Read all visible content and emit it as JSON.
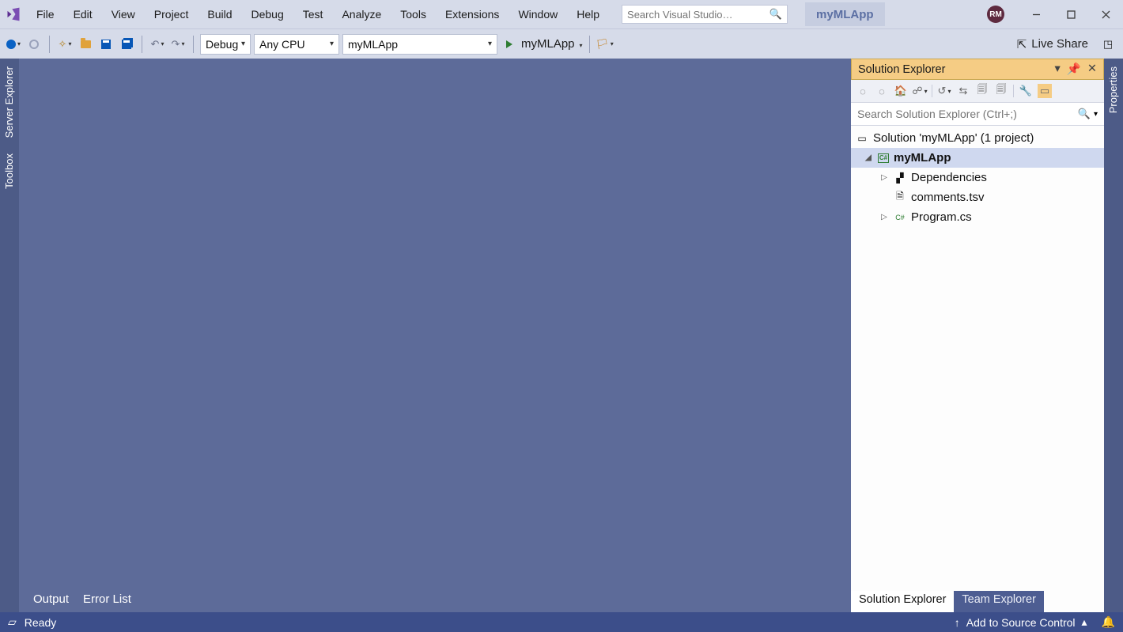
{
  "menu": [
    "File",
    "Edit",
    "View",
    "Project",
    "Build",
    "Debug",
    "Test",
    "Analyze",
    "Tools",
    "Extensions",
    "Window",
    "Help"
  ],
  "search_placeholder": "Search Visual Studio…",
  "app_name": "myMLApp",
  "avatar_initials": "RM",
  "toolbar": {
    "config": "Debug",
    "platform": "Any CPU",
    "startup_project": "myMLApp",
    "start_label": "myMLApp",
    "live_share": "Live Share"
  },
  "left_wells": [
    "Server Explorer",
    "Toolbox"
  ],
  "right_wells": [
    "Properties"
  ],
  "bottom_tabs": [
    "Output",
    "Error List"
  ],
  "solution_explorer": {
    "title": "Solution Explorer",
    "search_placeholder": "Search Solution Explorer (Ctrl+;)",
    "solution_line": "Solution 'myMLApp' (1 project)",
    "project": "myMLApp",
    "children": [
      {
        "name": "Dependencies",
        "expandable": true
      },
      {
        "name": "comments.tsv",
        "expandable": false
      },
      {
        "name": "Program.cs",
        "expandable": true
      }
    ],
    "tabs": {
      "active": "Solution Explorer",
      "inactive": "Team Explorer"
    }
  },
  "status": {
    "left": "Ready",
    "right": "Add to Source Control"
  }
}
